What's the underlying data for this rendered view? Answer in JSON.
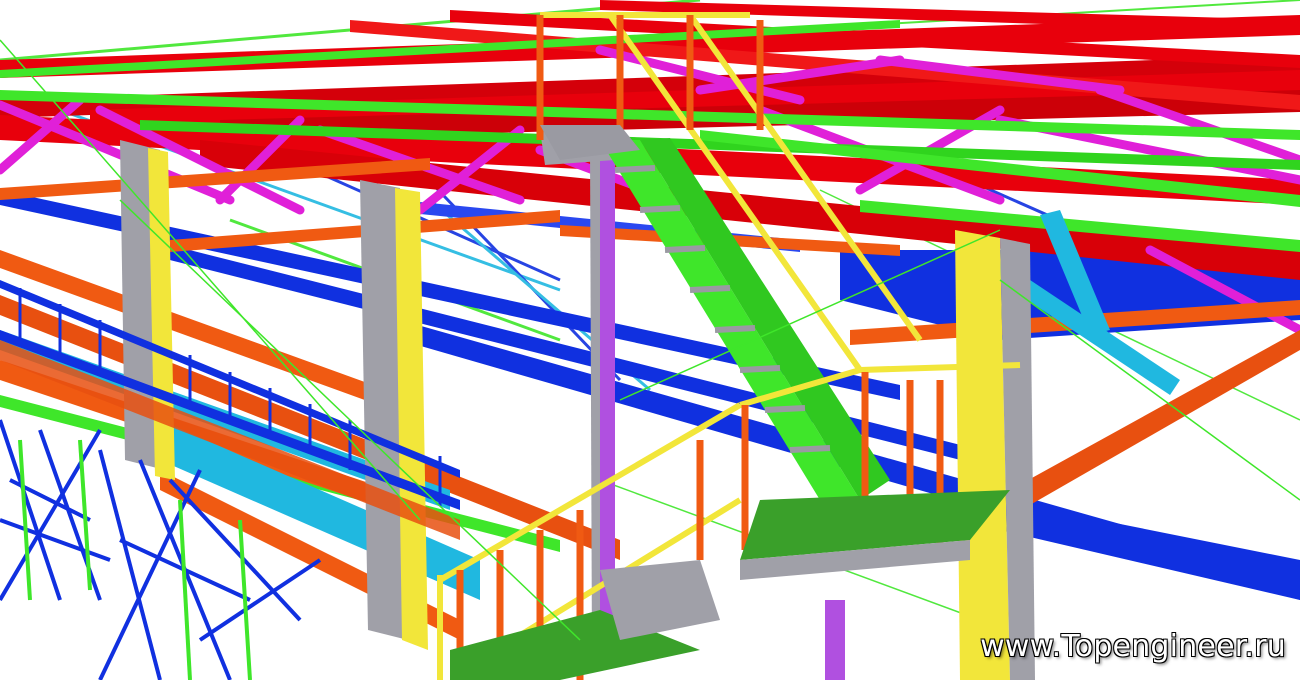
{
  "watermark": "www.Topengineer.ru",
  "colors": {
    "red": "#e8000c",
    "magenta": "#e020d8",
    "green": "#3fe62a",
    "blue": "#1030e0",
    "orange": "#f05a12",
    "yellow": "#f2e63a",
    "gray": "#a0a0a8",
    "cyan": "#20b8e0",
    "violet": "#b050e0"
  }
}
